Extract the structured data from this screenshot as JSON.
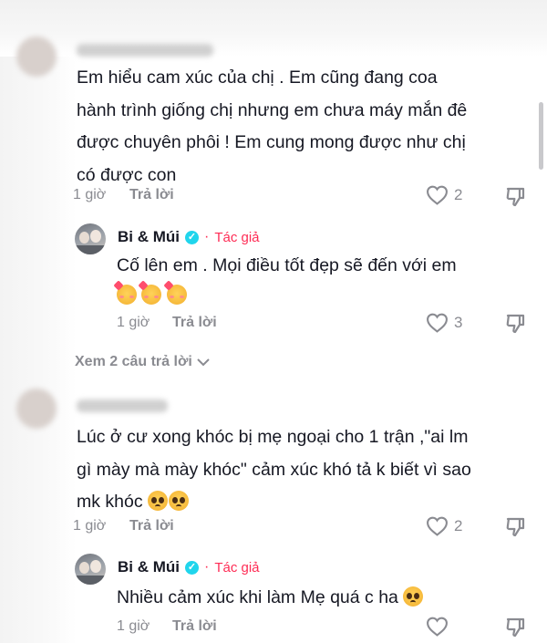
{
  "comments": [
    {
      "lines": [
        "Em hiểu cam xúc của chị . Em cũng đang coa",
        "hành trình giống chị nhưng em chưa máy mắn đê",
        "được chuyên phôi ! Em cung mong được như chị",
        "có được con"
      ],
      "time": "1 giờ",
      "reply_label": "Trả lời",
      "likes": "2",
      "reply": {
        "author": "Bi & Múi",
        "badge": "Tác giả",
        "text": "Cố lên em . Mọi điều tốt đẹp sẽ đến với em",
        "emojis": [
          "blush-hearts-emoji",
          "blush-hearts-emoji",
          "blush-hearts-emoji"
        ],
        "time": "1 giờ",
        "reply_label": "Trả lời",
        "likes": "3"
      },
      "view_replies": "Xem 2 câu trả lời"
    },
    {
      "lines": [
        "Lúc ở cư xong khóc bị mẹ ngoại cho 1 trận ,\"ai lm",
        "gì mày mà mày khóc\" cảm xúc khó tả k biết vì sao",
        "mk khóc"
      ],
      "emojis": [
        "pleading-face-emoji",
        "pleading-face-emoji"
      ],
      "time": "1 giờ",
      "reply_label": "Trả lời",
      "likes": "2",
      "reply": {
        "author": "Bi & Múi",
        "badge": "Tác giả",
        "text": "Nhiều cảm xúc khi làm Mẹ quá c ha",
        "emojis": [
          "pleading-face-emoji"
        ],
        "time": "1 giờ",
        "reply_label": "Trả lời"
      }
    }
  ],
  "colors": {
    "text": "#161823",
    "muted": "#8a8b91",
    "accent": "#fe2c55",
    "verified": "#20d5ec"
  }
}
